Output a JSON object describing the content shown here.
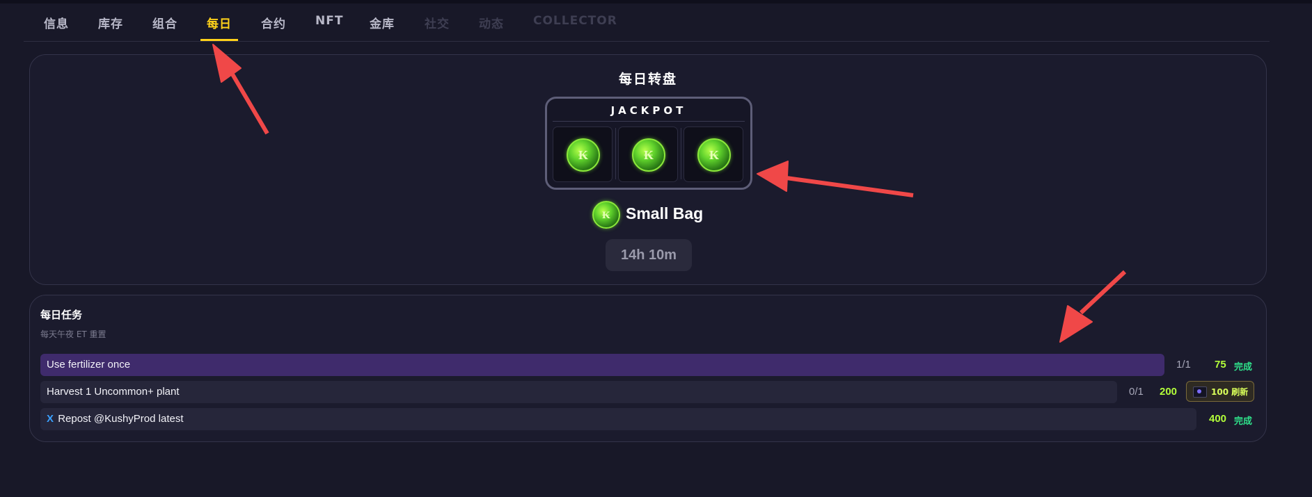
{
  "nav": {
    "tabs": [
      {
        "label": "信息",
        "state": "normal"
      },
      {
        "label": "库存",
        "state": "normal"
      },
      {
        "label": "组合",
        "state": "normal"
      },
      {
        "label": "每日",
        "state": "active"
      },
      {
        "label": "合约",
        "state": "normal"
      },
      {
        "label": "NFT",
        "state": "normal"
      },
      {
        "label": "金库",
        "state": "normal"
      },
      {
        "label": "社交",
        "state": "disabled"
      },
      {
        "label": "动态",
        "state": "disabled"
      },
      {
        "label": "COLLECTOR",
        "state": "disabled"
      }
    ]
  },
  "spin": {
    "title": "每日转盘",
    "jackpot_label": "JACKPOT",
    "slots": [
      {
        "icon": "green-coin-icon"
      },
      {
        "icon": "green-coin-icon"
      },
      {
        "icon": "green-coin-icon"
      }
    ],
    "prize_label": "Small Bag",
    "timer": "14h 10m"
  },
  "tasks": {
    "title": "每日任务",
    "subtitle": "每天午夜 ET 重置",
    "items": [
      {
        "label": "Use fertilizer once",
        "progress": "1/1",
        "reward": "75",
        "status": "完成"
      },
      {
        "label": "Harvest 1 Uncommon+ plant",
        "progress": "0/1",
        "reward": "200",
        "action": "100 刷新"
      },
      {
        "icon_glyph": "X",
        "label": "Repost @KushyProd latest",
        "reward": "400",
        "status": "完成"
      }
    ]
  },
  "colors": {
    "background": "#181828",
    "accent_yellow": "#ffd21a",
    "reward_green": "#b3ff3a",
    "status_green": "#2fe08a",
    "task_done_purple": "#3f2b6c",
    "annotation_red": "#f04848"
  }
}
